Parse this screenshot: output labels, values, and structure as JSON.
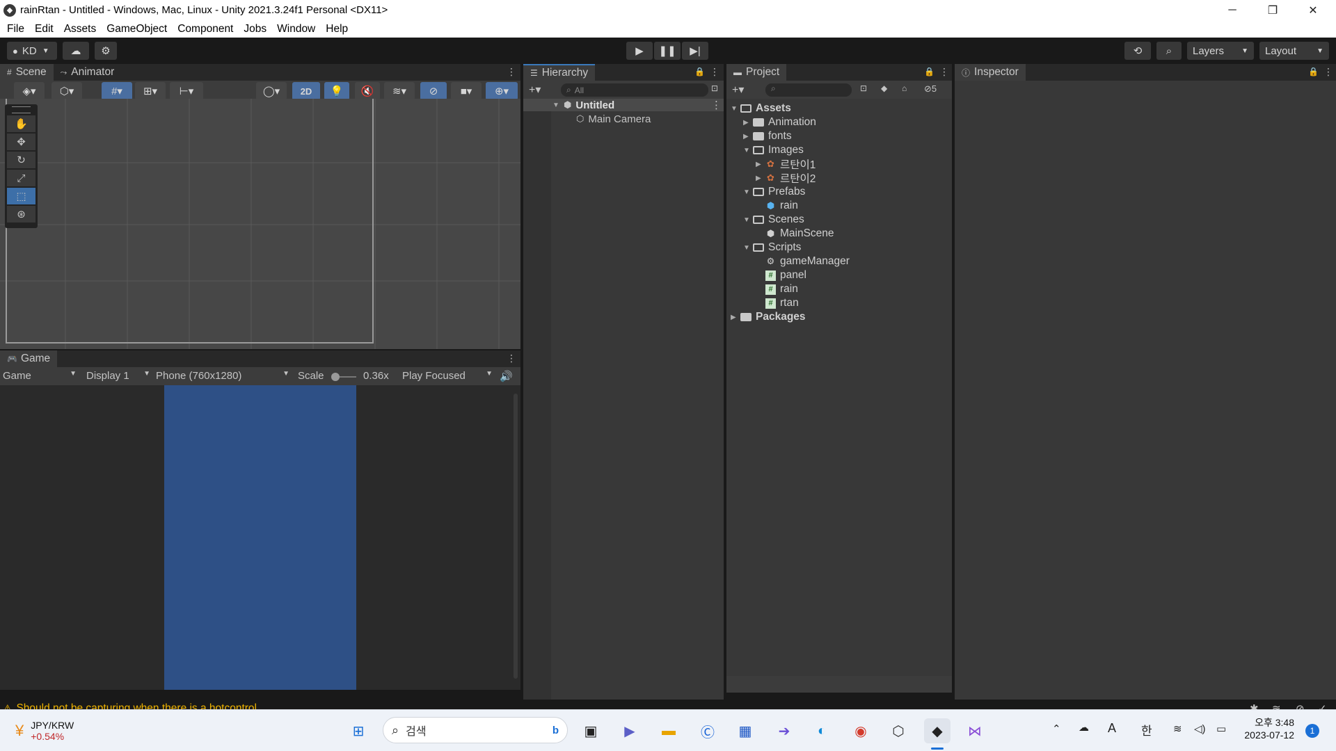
{
  "window": {
    "title": "rainRtan - Untitled - Windows, Mac, Linux - Unity 2021.3.24f1 Personal <DX11>"
  },
  "menu": [
    "File",
    "Edit",
    "Assets",
    "GameObject",
    "Component",
    "Jobs",
    "Window",
    "Help"
  ],
  "toolbar": {
    "account": "KD",
    "layers": "Layers",
    "layout": "Layout"
  },
  "scene_panel": {
    "tabs": [
      "Scene",
      "Animator"
    ],
    "mode_2d": "2D"
  },
  "game_panel": {
    "tab": "Game",
    "view_select": "Game",
    "display": "Display 1",
    "resolution": "Phone (760x1280)",
    "scale_label": "Scale",
    "scale_value": "0.36x",
    "play_mode": "Play Focused",
    "scale_fraction": 0.06,
    "game_bg": "#2e5086"
  },
  "hierarchy": {
    "tab": "Hierarchy",
    "search_placeholder": "All",
    "scene": "Untitled",
    "items": [
      "Main Camera"
    ]
  },
  "project": {
    "tab": "Project",
    "hidden_count": "5",
    "root": "Assets",
    "folders": [
      {
        "name": "Animation",
        "children": []
      },
      {
        "name": "fonts",
        "children": []
      },
      {
        "name": "Images",
        "children": [
          "르탄이1",
          "르탄이2"
        ]
      },
      {
        "name": "Prefabs",
        "children": [
          "rain"
        ]
      },
      {
        "name": "Scenes",
        "children": [
          "MainScene"
        ]
      },
      {
        "name": "Scripts",
        "children": [
          "gameManager",
          "panel",
          "rain",
          "rtan"
        ]
      }
    ],
    "packages": "Packages"
  },
  "inspector": {
    "tab": "Inspector"
  },
  "status": {
    "message": "Should not be capturing when there is a hotcontrol",
    "warning_color": "#f0b400"
  },
  "taskbar": {
    "widget_name": "JPY/KRW",
    "widget_change": "+0.54%",
    "search_placeholder": "검색",
    "ime": "한",
    "font_indicator": "A",
    "time": "오후 3:48",
    "date": "2023-07-12",
    "notifications": "1"
  }
}
